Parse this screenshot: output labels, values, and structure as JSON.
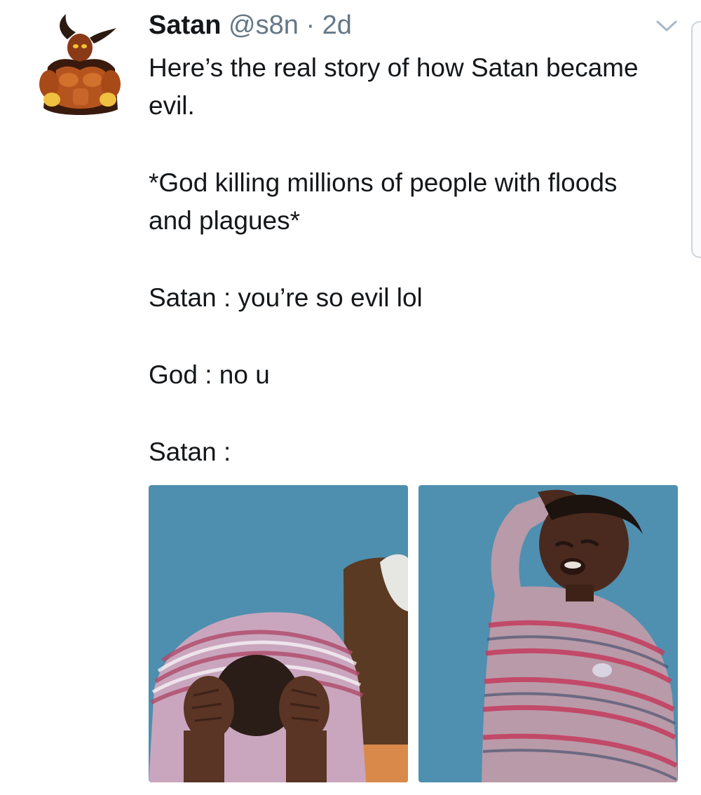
{
  "tweet": {
    "author": {
      "display_name": "Satan",
      "handle": "@s8n",
      "separator": "·",
      "time": "2d"
    },
    "paragraphs": [
      "Here’s the real story of how Satan became evil.",
      "*God killing millions of people with floods and plagues*",
      "Satan : you’re so evil lol",
      "God : no u",
      "Satan :"
    ],
    "avatar_icon": "horned-demon-avatar",
    "menu_icon": "chevron-down-icon",
    "media": [
      {
        "icon": "crying-child-head-in-hands-photo"
      },
      {
        "icon": "crying-child-hand-on-head-photo"
      }
    ]
  }
}
